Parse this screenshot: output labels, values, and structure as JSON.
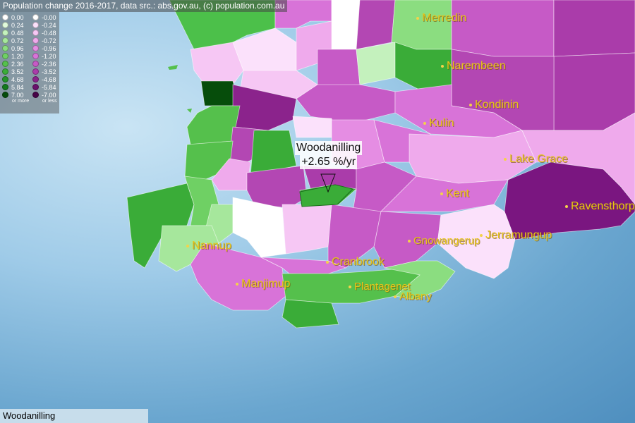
{
  "title": "Population change 2016-2017, data src.: abs.gov.au, (c) population.com.au",
  "legend": {
    "positive": [
      {
        "label": "0.00",
        "color": "#ffffff"
      },
      {
        "label": "0.24",
        "color": "#e0fadc"
      },
      {
        "label": "0.48",
        "color": "#c4f1bd"
      },
      {
        "label": "0.72",
        "color": "#a6e79c"
      },
      {
        "label": "0.96",
        "color": "#8bdd80"
      },
      {
        "label": "1.20",
        "color": "#6fd064"
      },
      {
        "label": "2.36",
        "color": "#55c04c"
      },
      {
        "label": "3.52",
        "color": "#3aac38"
      },
      {
        "label": "4.68",
        "color": "#24942a"
      },
      {
        "label": "5.84",
        "color": "#137a1c"
      },
      {
        "label": "7.00",
        "color": "#064d0b"
      }
    ],
    "negative": [
      {
        "label": "-0.00",
        "color": "#ffffff"
      },
      {
        "label": "-0.24",
        "color": "#fbe1fb"
      },
      {
        "label": "-0.48",
        "color": "#f6c7f4"
      },
      {
        "label": "-0.72",
        "color": "#efaaec"
      },
      {
        "label": "-0.96",
        "color": "#e58de3"
      },
      {
        "label": "-1.20",
        "color": "#d873d8"
      },
      {
        "label": "-2.36",
        "color": "#c65ac6"
      },
      {
        "label": "-3.52",
        "color": "#aa3caa"
      },
      {
        "label": "-4.68",
        "color": "#8b238c"
      },
      {
        "label": "-5.84",
        "color": "#6a106c"
      },
      {
        "label": "-7.00",
        "color": "#470447"
      }
    ],
    "pos_note": "or more",
    "neg_note": "or less"
  },
  "towns": [
    {
      "name": "Merredin"
    },
    {
      "name": "Narembeen"
    },
    {
      "name": "Kondinin"
    },
    {
      "name": "Kulin"
    },
    {
      "name": "Lake Grace"
    },
    {
      "name": "Kent"
    },
    {
      "name": "Ravensthorpe"
    },
    {
      "name": "Jerramungup"
    },
    {
      "name": "Gnowangerup"
    },
    {
      "name": "Cranbrook"
    },
    {
      "name": "Nannup"
    },
    {
      "name": "Manjimup"
    },
    {
      "name": "Plantagenet"
    },
    {
      "name": "Albany"
    }
  ],
  "callout": {
    "name": "Woodanilling",
    "value": "+2.65 %/yr"
  },
  "footer": {
    "selected": "Woodanilling"
  }
}
